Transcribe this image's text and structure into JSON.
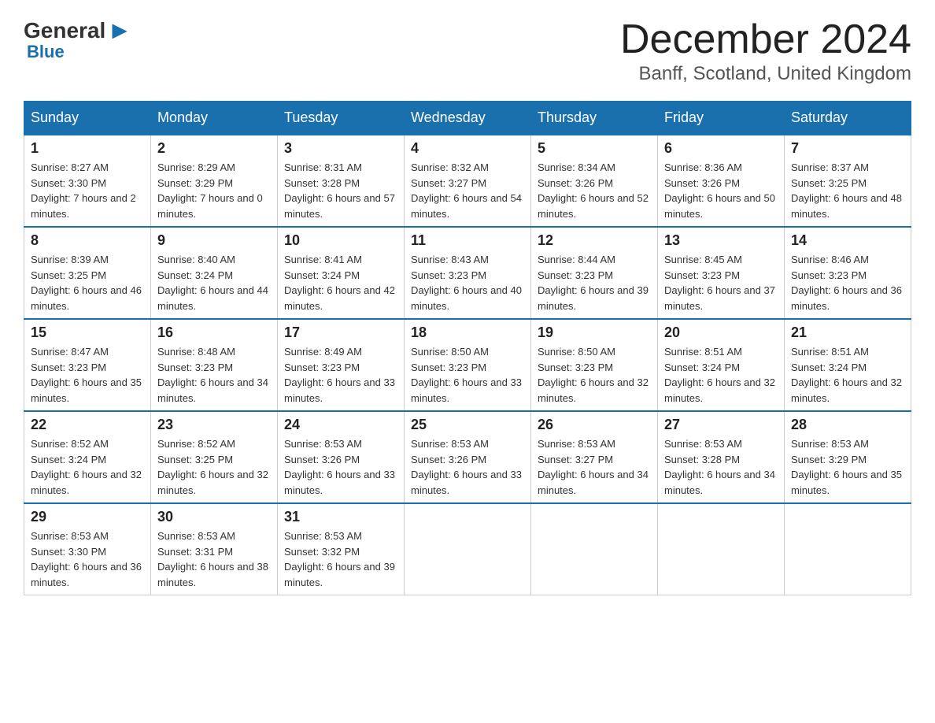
{
  "header": {
    "logo": {
      "general": "General",
      "blue": "Blue"
    },
    "title": "December 2024",
    "location": "Banff, Scotland, United Kingdom"
  },
  "days_of_week": [
    "Sunday",
    "Monday",
    "Tuesday",
    "Wednesday",
    "Thursday",
    "Friday",
    "Saturday"
  ],
  "weeks": [
    [
      {
        "day": "1",
        "sunrise": "8:27 AM",
        "sunset": "3:30 PM",
        "daylight": "7 hours and 2 minutes."
      },
      {
        "day": "2",
        "sunrise": "8:29 AM",
        "sunset": "3:29 PM",
        "daylight": "7 hours and 0 minutes."
      },
      {
        "day": "3",
        "sunrise": "8:31 AM",
        "sunset": "3:28 PM",
        "daylight": "6 hours and 57 minutes."
      },
      {
        "day": "4",
        "sunrise": "8:32 AM",
        "sunset": "3:27 PM",
        "daylight": "6 hours and 54 minutes."
      },
      {
        "day": "5",
        "sunrise": "8:34 AM",
        "sunset": "3:26 PM",
        "daylight": "6 hours and 52 minutes."
      },
      {
        "day": "6",
        "sunrise": "8:36 AM",
        "sunset": "3:26 PM",
        "daylight": "6 hours and 50 minutes."
      },
      {
        "day": "7",
        "sunrise": "8:37 AM",
        "sunset": "3:25 PM",
        "daylight": "6 hours and 48 minutes."
      }
    ],
    [
      {
        "day": "8",
        "sunrise": "8:39 AM",
        "sunset": "3:25 PM",
        "daylight": "6 hours and 46 minutes."
      },
      {
        "day": "9",
        "sunrise": "8:40 AM",
        "sunset": "3:24 PM",
        "daylight": "6 hours and 44 minutes."
      },
      {
        "day": "10",
        "sunrise": "8:41 AM",
        "sunset": "3:24 PM",
        "daylight": "6 hours and 42 minutes."
      },
      {
        "day": "11",
        "sunrise": "8:43 AM",
        "sunset": "3:23 PM",
        "daylight": "6 hours and 40 minutes."
      },
      {
        "day": "12",
        "sunrise": "8:44 AM",
        "sunset": "3:23 PM",
        "daylight": "6 hours and 39 minutes."
      },
      {
        "day": "13",
        "sunrise": "8:45 AM",
        "sunset": "3:23 PM",
        "daylight": "6 hours and 37 minutes."
      },
      {
        "day": "14",
        "sunrise": "8:46 AM",
        "sunset": "3:23 PM",
        "daylight": "6 hours and 36 minutes."
      }
    ],
    [
      {
        "day": "15",
        "sunrise": "8:47 AM",
        "sunset": "3:23 PM",
        "daylight": "6 hours and 35 minutes."
      },
      {
        "day": "16",
        "sunrise": "8:48 AM",
        "sunset": "3:23 PM",
        "daylight": "6 hours and 34 minutes."
      },
      {
        "day": "17",
        "sunrise": "8:49 AM",
        "sunset": "3:23 PM",
        "daylight": "6 hours and 33 minutes."
      },
      {
        "day": "18",
        "sunrise": "8:50 AM",
        "sunset": "3:23 PM",
        "daylight": "6 hours and 33 minutes."
      },
      {
        "day": "19",
        "sunrise": "8:50 AM",
        "sunset": "3:23 PM",
        "daylight": "6 hours and 32 minutes."
      },
      {
        "day": "20",
        "sunrise": "8:51 AM",
        "sunset": "3:24 PM",
        "daylight": "6 hours and 32 minutes."
      },
      {
        "day": "21",
        "sunrise": "8:51 AM",
        "sunset": "3:24 PM",
        "daylight": "6 hours and 32 minutes."
      }
    ],
    [
      {
        "day": "22",
        "sunrise": "8:52 AM",
        "sunset": "3:24 PM",
        "daylight": "6 hours and 32 minutes."
      },
      {
        "day": "23",
        "sunrise": "8:52 AM",
        "sunset": "3:25 PM",
        "daylight": "6 hours and 32 minutes."
      },
      {
        "day": "24",
        "sunrise": "8:53 AM",
        "sunset": "3:26 PM",
        "daylight": "6 hours and 33 minutes."
      },
      {
        "day": "25",
        "sunrise": "8:53 AM",
        "sunset": "3:26 PM",
        "daylight": "6 hours and 33 minutes."
      },
      {
        "day": "26",
        "sunrise": "8:53 AM",
        "sunset": "3:27 PM",
        "daylight": "6 hours and 34 minutes."
      },
      {
        "day": "27",
        "sunrise": "8:53 AM",
        "sunset": "3:28 PM",
        "daylight": "6 hours and 34 minutes."
      },
      {
        "day": "28",
        "sunrise": "8:53 AM",
        "sunset": "3:29 PM",
        "daylight": "6 hours and 35 minutes."
      }
    ],
    [
      {
        "day": "29",
        "sunrise": "8:53 AM",
        "sunset": "3:30 PM",
        "daylight": "6 hours and 36 minutes."
      },
      {
        "day": "30",
        "sunrise": "8:53 AM",
        "sunset": "3:31 PM",
        "daylight": "6 hours and 38 minutes."
      },
      {
        "day": "31",
        "sunrise": "8:53 AM",
        "sunset": "3:32 PM",
        "daylight": "6 hours and 39 minutes."
      },
      null,
      null,
      null,
      null
    ]
  ]
}
